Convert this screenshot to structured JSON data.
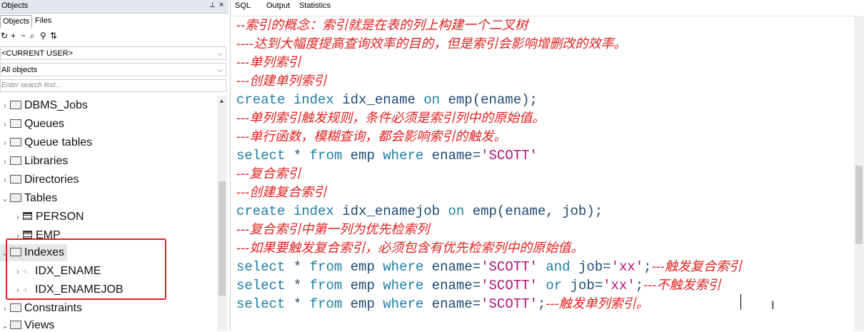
{
  "left": {
    "panel_title": "Objects",
    "pin": "ยม",
    "close": "×",
    "tabs": [
      "Objects",
      "Files"
    ],
    "toolbar_icons": [
      "↶",
      "+",
      "−",
      "ด",
      "☘",
      "↻"
    ],
    "user_select": "<CURRENT USER>",
    "scope_select": "All objects",
    "search_placeholder": "Enter search text...",
    "tree": [
      {
        "label": "DBMS_Jobs",
        "type": "folder",
        "expanded": false
      },
      {
        "label": "Queues",
        "type": "folder",
        "expanded": false
      },
      {
        "label": "Queue tables",
        "type": "folder",
        "expanded": false
      },
      {
        "label": "Libraries",
        "type": "folder",
        "expanded": false
      },
      {
        "label": "Directories",
        "type": "folder",
        "expanded": false
      },
      {
        "label": "Tables",
        "type": "folder",
        "expanded": true
      },
      {
        "label": "PERSON",
        "type": "table"
      },
      {
        "label": "EMP",
        "type": "table"
      },
      {
        "label": "Indexes",
        "type": "folder",
        "expanded": true
      },
      {
        "label": "IDX_ENAME",
        "type": "index"
      },
      {
        "label": "IDX_ENAMEJOB",
        "type": "index"
      },
      {
        "label": "Constraints",
        "type": "folder",
        "expanded": false
      },
      {
        "label": "Views",
        "type": "folder",
        "expanded": true
      }
    ]
  },
  "editor": {
    "tabs": [
      "SQL",
      "Output",
      "Statistics"
    ],
    "lines": {
      "l1": "--索引的概念：索引就是在表的列上构建一个二叉树",
      "l2": "----达到大幅度提高查询效率的目的，但是索引会影响增删改的效率。",
      "l3": "---单列索引",
      "l4": "---创建单列索引",
      "l5a": "create",
      "l5b": " index ",
      "l5c": "idx_ename",
      "l5d": " on ",
      "l5e": "emp(ename);",
      "l6": "---单列索引触发规则，条件必须是索引列中的原始值。",
      "l7": "---单行函数，模糊查询，都会影响索引的触发。",
      "l8a": "select",
      "l8b": " * ",
      "l8c": "from",
      "l8d": " emp ",
      "l8e": "where",
      "l8f": " ename=",
      "l8g": "'SCOTT'",
      "l9": "---复合索引",
      "l10": "---创建复合索引",
      "l11a": "create",
      "l11b": " index ",
      "l11c": "idx_enamejob",
      "l11d": " on ",
      "l11e": "emp(ename, job);",
      "l12": "---复合索引中第一列为优先检索列",
      "l13": "---如果要触发复合索引，必须包含有优先检索列中的原始值。",
      "l14a": "select",
      "l14b": " * ",
      "l14c": "from",
      "l14d": " emp ",
      "l14e": "where",
      "l14f": " ename=",
      "l14g": "'SCOTT'",
      "l14h": " and ",
      "l14i": "job=",
      "l14j": "'xx'",
      "l14k": ";",
      "l14l": "---触发复合索引",
      "l15a": "select",
      "l15b": " * ",
      "l15c": "from",
      "l15d": " emp ",
      "l15e": "where",
      "l15f": " ename=",
      "l15g": "'SCOTT'",
      "l15h": " or ",
      "l15i": "job=",
      "l15j": "'xx'",
      "l15k": ";",
      "l15l": "---不触发索引",
      "l16a": "select",
      "l16b": " * ",
      "l16c": "from",
      "l16d": " emp ",
      "l16e": "where",
      "l16f": " ename=",
      "l16g": "'SCOTT'",
      "l16h": ";",
      "l16i": "---触发单列索引。"
    }
  },
  "colors": {
    "comment": "#e02020",
    "keyword": "#1d7fa3",
    "string": "#b0147a",
    "highlight_box": "#e02020"
  }
}
